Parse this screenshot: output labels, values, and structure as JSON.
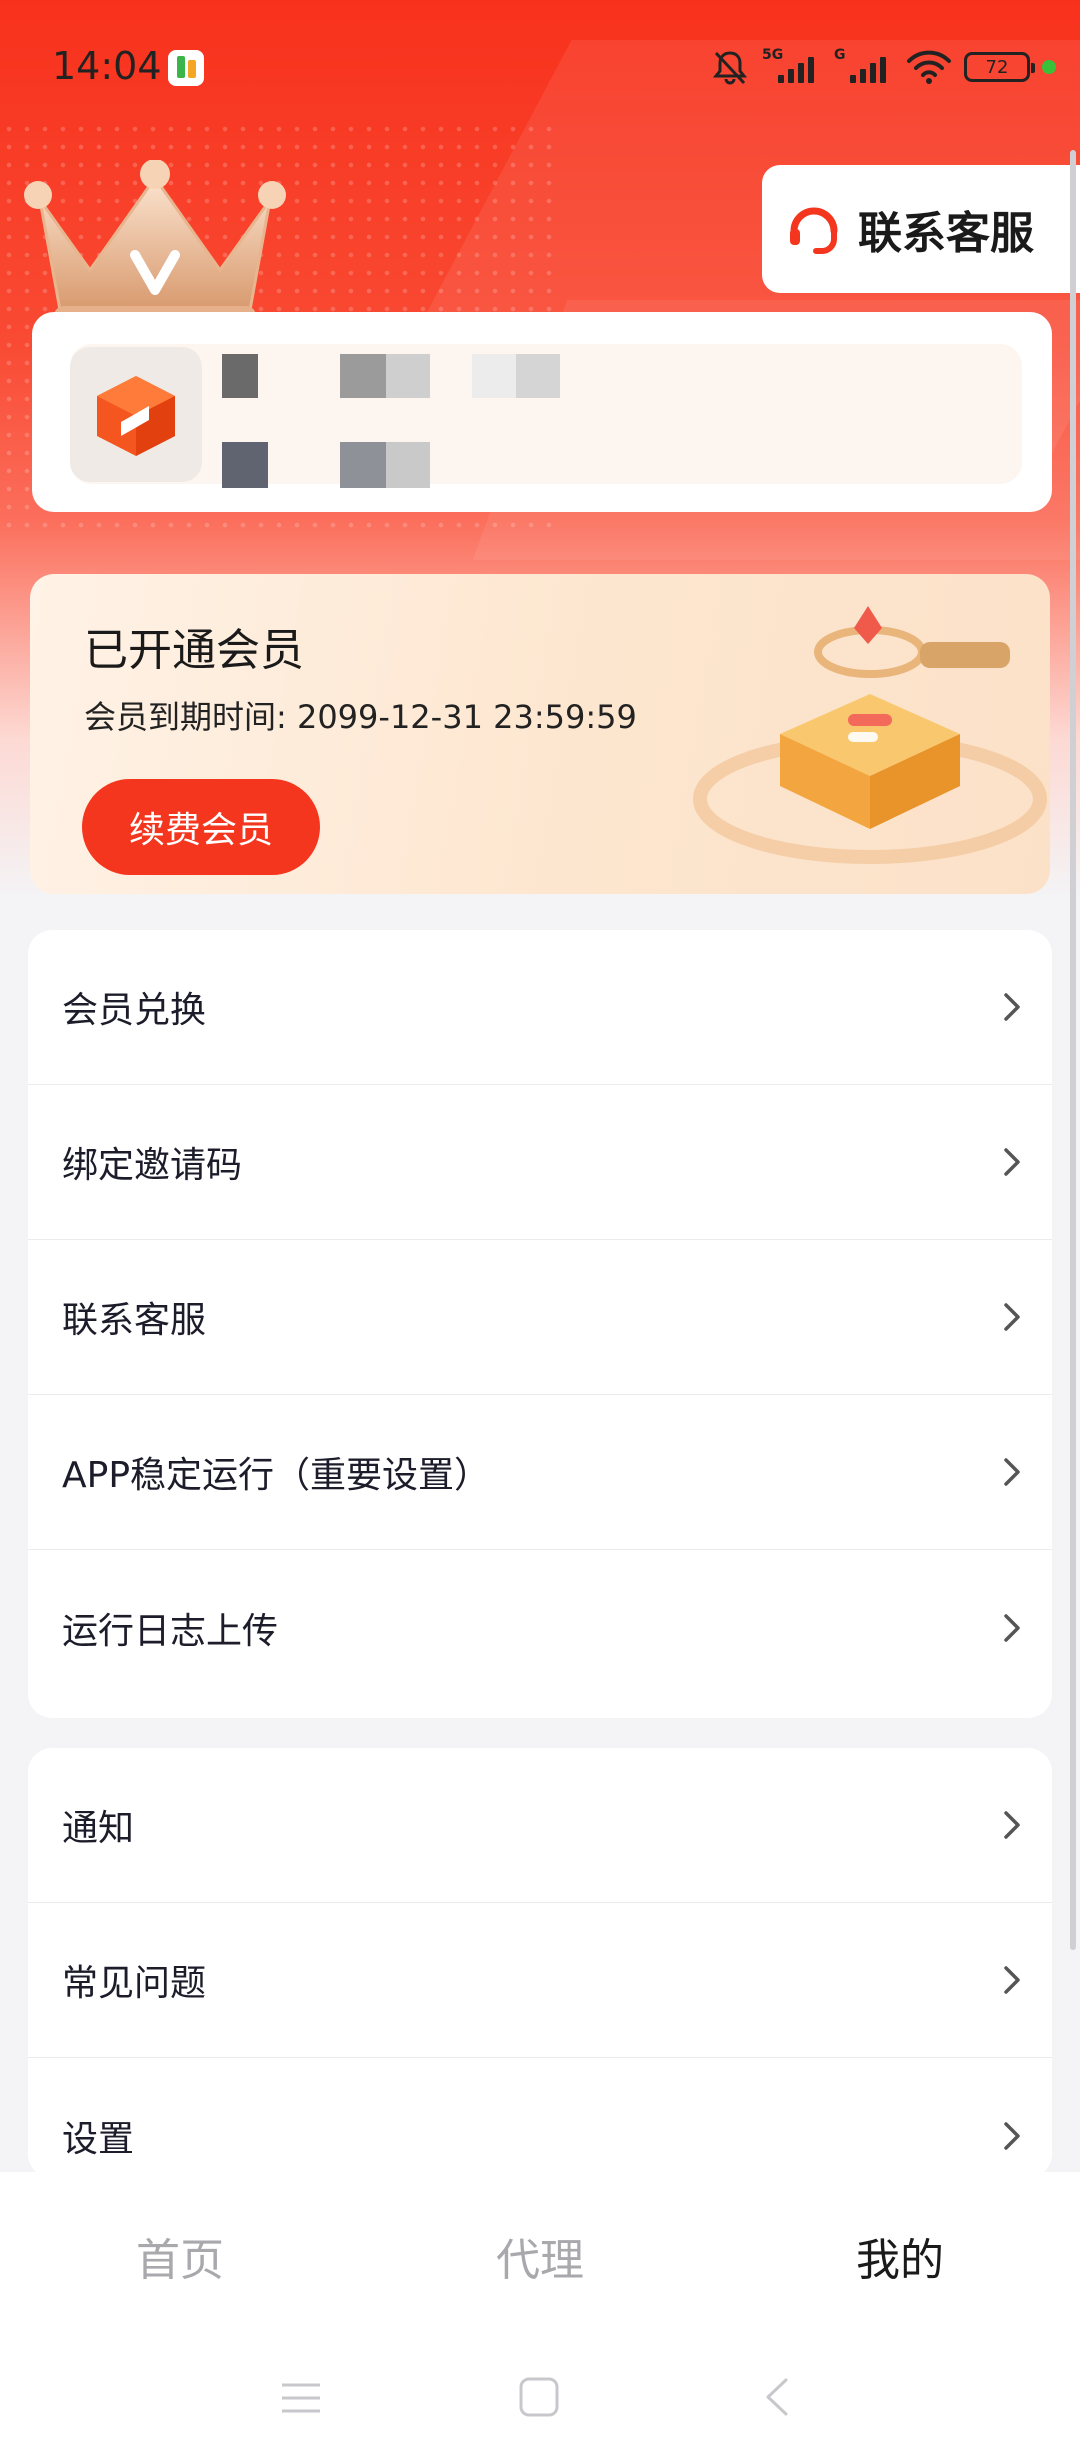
{
  "status_bar": {
    "time": "14:04",
    "network1": "5G",
    "network2": "G",
    "battery": "72",
    "icons": [
      "app-notification-icon",
      "mute-bell-icon",
      "signal-icon",
      "wifi-icon",
      "battery-icon"
    ]
  },
  "header": {
    "contact_label": "联系客服"
  },
  "membership": {
    "title": "已开通会员",
    "expire_text": "会员到期时间: 2099-12-31 23:59:59",
    "renew_label": "续费会员"
  },
  "menu_group1": [
    {
      "label": "会员兑换"
    },
    {
      "label": "绑定邀请码"
    },
    {
      "label": "联系客服"
    },
    {
      "label": "APP稳定运行（重要设置）"
    },
    {
      "label": "运行日志上传"
    }
  ],
  "menu_group2": [
    {
      "label": "通知"
    },
    {
      "label": "常见问题"
    },
    {
      "label": "设置"
    }
  ],
  "tabs": [
    {
      "label": "首页",
      "active": false
    },
    {
      "label": "代理",
      "active": false
    },
    {
      "label": "我的",
      "active": true
    }
  ],
  "colors": {
    "brand_red": "#f5361f",
    "header_red": "#f8311c",
    "active_tab": "#1a1a1a",
    "inactive_tab": "#a8a8ad"
  }
}
